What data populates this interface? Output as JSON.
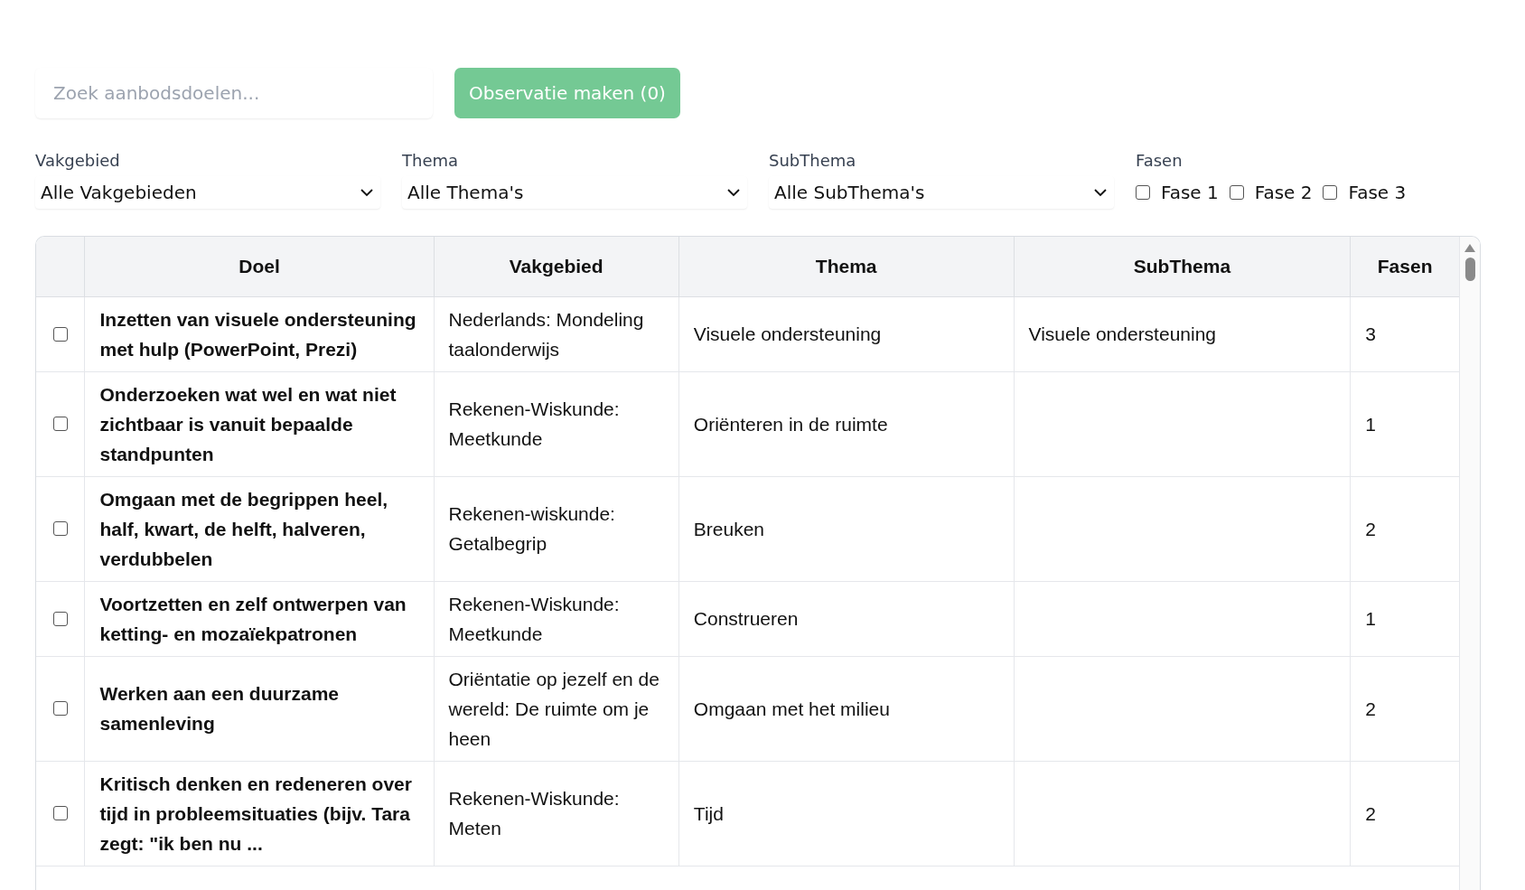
{
  "search": {
    "placeholder": "Zoek aanbodsdoelen..."
  },
  "action_button": {
    "label": "Observatie maken (0)",
    "disabled": true
  },
  "filters": [
    {
      "label": "Vakgebied",
      "value": "Alle Vakgebieden"
    },
    {
      "label": "Thema",
      "value": "Alle Thema's"
    },
    {
      "label": "SubThema",
      "value": "Alle SubThema's"
    }
  ],
  "phases": {
    "label": "Fasen",
    "options": [
      {
        "label": "Fase 1",
        "checked": false
      },
      {
        "label": "Fase 2",
        "checked": false
      },
      {
        "label": "Fase 3",
        "checked": false
      }
    ]
  },
  "table": {
    "columns": [
      "Doel",
      "Vakgebied",
      "Thema",
      "SubThema",
      "Fasen"
    ],
    "rows": [
      {
        "selected": false,
        "cells": [
          "Inzetten van visuele ondersteuning met hulp (PowerPoint, Prezi)",
          "Nederlands: Mondeling taalonderwijs",
          "Visuele ondersteuning",
          "Visuele ondersteuning",
          "3"
        ]
      },
      {
        "selected": false,
        "cells": [
          "Onderzoeken wat wel en wat niet zichtbaar is vanuit bepaalde standpunten",
          "Rekenen-Wiskunde: Meetkunde",
          "Oriënteren in de ruimte",
          "",
          "1"
        ]
      },
      {
        "selected": false,
        "cells": [
          "Omgaan met de begrippen heel, half, kwart, de helft, halveren, verdubbelen",
          "Rekenen-wiskunde: Getalbegrip",
          "Breuken",
          "",
          "2"
        ]
      },
      {
        "selected": false,
        "cells": [
          "Voortzetten en zelf ontwerpen van ketting- en mozaïekpatronen",
          "Rekenen-Wiskunde: Meetkunde",
          "Construeren",
          "",
          "1"
        ]
      },
      {
        "selected": false,
        "cells": [
          "Werken aan een duurzame samenleving",
          "Oriëntatie op jezelf en de wereld: De ruimte om je heen",
          "Omgaan met het milieu",
          "",
          "2"
        ]
      },
      {
        "selected": false,
        "cells": [
          "Kritisch denken en redeneren over tijd in probleemsituaties (bijv. Tara zegt: \"ik ben nu ...",
          "Rekenen-Wiskunde: Meten",
          "Tijd",
          "",
          "2"
        ]
      }
    ]
  }
}
